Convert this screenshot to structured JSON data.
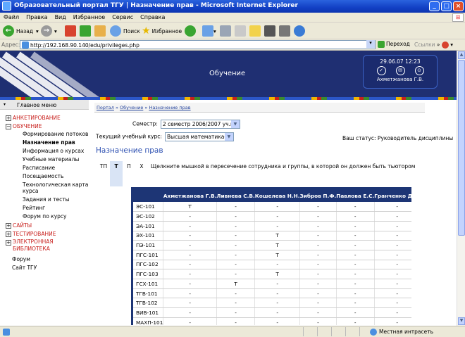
{
  "window": {
    "title": "Образовательный портал ТГУ | Назначение прав - Microsoft Internet Explorer"
  },
  "menu": [
    "Файл",
    "Правка",
    "Вид",
    "Избранное",
    "Сервис",
    "Справка"
  ],
  "toolbar": {
    "back": "Назад",
    "search": "Поиск",
    "favorites": "Избранное"
  },
  "address": {
    "label": "Адрес:",
    "url": "http://192.168.90.140/edu/privileges.php",
    "go": "Переход",
    "links": "Ссылки"
  },
  "status": {
    "zone": "Местная интрасеть"
  },
  "banner": {
    "title": "Обучение",
    "datetime": "29.06.07 12:23",
    "user": "Ахметжанова Г.В."
  },
  "sidebar": {
    "header": "Главное меню",
    "sections": [
      {
        "label": "АНКЕТИРОВАНИЕ",
        "expanded": false
      },
      {
        "label": "ОБУЧЕНИЕ",
        "expanded": true,
        "items": [
          {
            "label": "Формирование потоков",
            "active": false
          },
          {
            "label": "Назначение прав",
            "active": true
          },
          {
            "label": "Информация о курсах",
            "active": false
          },
          {
            "label": "Учебные материалы",
            "active": false
          },
          {
            "label": "Расписание",
            "active": false
          },
          {
            "label": "Посещаемость",
            "active": false
          },
          {
            "label": "Технологическая карта курса",
            "active": false
          },
          {
            "label": "Задания и тесты",
            "active": false
          },
          {
            "label": "Рейтинг",
            "active": false
          },
          {
            "label": "Форум по курсу",
            "active": false
          }
        ]
      },
      {
        "label": "САЙТЫ",
        "expanded": false
      },
      {
        "label": "ТЕСТИРОВАНИЕ",
        "expanded": false
      },
      {
        "label": "ЭЛЕКТРОННАЯ БИБЛИОТЕКА",
        "expanded": false
      }
    ],
    "extra": [
      "Форум",
      "Сайт ТГУ"
    ]
  },
  "breadcrumb": [
    "Портал",
    "Обучение",
    "Назначение прав"
  ],
  "form": {
    "semester_label": "Семестр:",
    "semester_value": "2 семестр 2006/2007 уч.г",
    "course_label": "Текущий учебный курс:",
    "course_value": "Высшая математика-2",
    "status_text": "Ваш статус: Руководитель дисциплины"
  },
  "page_title": "Назначение прав",
  "tabs": [
    {
      "label": "ТП",
      "active": false
    },
    {
      "label": "Т",
      "active": true
    },
    {
      "label": "П",
      "active": false
    },
    {
      "label": "Х",
      "active": false
    }
  ],
  "instruction": "Щелкните мышкой в пересечение сотрудника и группы, в которой он должен быть тьютором",
  "grid": {
    "columns": [
      "Ахметжанова Г.В.",
      "Ливнева С.В.",
      "Кошелева Н.Н.",
      "Зибров П.Ф.",
      "Павлова Е.С.",
      "Гранченко Д.В."
    ],
    "rows": [
      {
        "group": "ЭС-101",
        "cells": [
          "Т",
          "-",
          "-",
          "-",
          "-",
          "-"
        ]
      },
      {
        "group": "ЭС-102",
        "cells": [
          "-",
          "-",
          "-",
          "-",
          "-",
          "-"
        ]
      },
      {
        "group": "ЭА-101",
        "cells": [
          "-",
          "-",
          "-",
          "-",
          "-",
          "-"
        ]
      },
      {
        "group": "ЭХ-101",
        "cells": [
          "-",
          "-",
          "Т",
          "-",
          "-",
          "-"
        ]
      },
      {
        "group": "ПЭ-101",
        "cells": [
          "-",
          "-",
          "Т",
          "-",
          "-",
          "-"
        ]
      },
      {
        "group": "ПГС-101",
        "cells": [
          "-",
          "-",
          "Т",
          "-",
          "-",
          "-"
        ]
      },
      {
        "group": "ПГС-102",
        "cells": [
          "-",
          "-",
          "-",
          "-",
          "-",
          "-"
        ]
      },
      {
        "group": "ПГС-103",
        "cells": [
          "-",
          "-",
          "Т",
          "-",
          "-",
          "-"
        ]
      },
      {
        "group": "ГСХ-101",
        "cells": [
          "-",
          "Т",
          "-",
          "-",
          "-",
          "-"
        ]
      },
      {
        "group": "ТГВ-101",
        "cells": [
          "-",
          "-",
          "-",
          "-",
          "-",
          "-"
        ]
      },
      {
        "group": "ТГВ-102",
        "cells": [
          "-",
          "-",
          "-",
          "-",
          "-",
          "-"
        ]
      },
      {
        "group": "ВИВ-101",
        "cells": [
          "-",
          "-",
          "-",
          "-",
          "-",
          "-"
        ]
      },
      {
        "group": "МАХП-101",
        "cells": [
          "-",
          "-",
          "-",
          "-",
          "-",
          "-"
        ]
      }
    ]
  }
}
